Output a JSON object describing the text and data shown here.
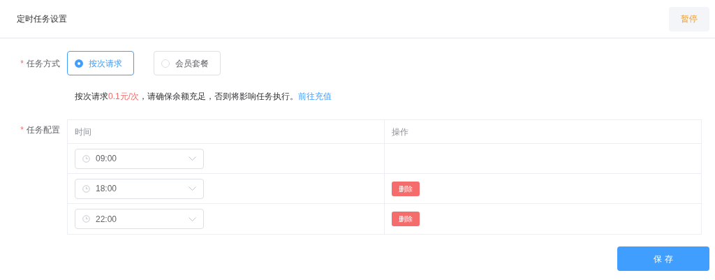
{
  "header": {
    "title": "定时任务设置",
    "pause_button": "暂停"
  },
  "mode": {
    "label": "任务方式",
    "required_mark": "*",
    "options": [
      {
        "label": "按次请求",
        "selected": true
      },
      {
        "label": "会员套餐",
        "selected": false
      }
    ]
  },
  "hint": {
    "prefix": "按次请求",
    "price": "0.1元/次",
    "suffix": "，请确保余额充足，否则将影响任务执行。",
    "link": "前往充值"
  },
  "config": {
    "label": "任务配置",
    "required_mark": "*",
    "columns": [
      "时间",
      "操作"
    ],
    "rows": [
      {
        "time": "09:00"
      },
      {
        "time": "18:00",
        "action": "删除"
      },
      {
        "time": "22:00",
        "action": "删除"
      }
    ]
  },
  "save_button": "保 存"
}
